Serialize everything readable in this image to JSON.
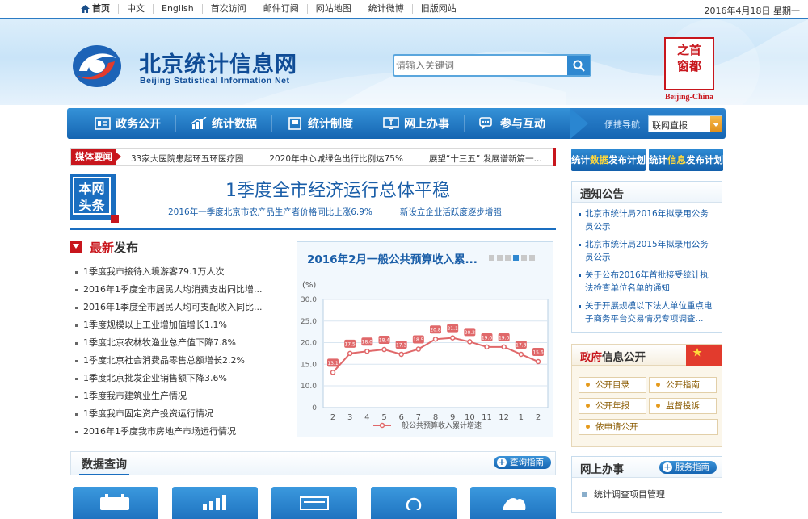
{
  "topbar": {
    "home": "首页",
    "links": [
      "中文",
      "English",
      "首次访问",
      "邮件订阅",
      "网站地图",
      "统计微博",
      "旧版网站"
    ],
    "date": "2016年4月18日 星期一"
  },
  "header": {
    "title": "北京统计信息网",
    "subtitle": "Beijing Statistical Information Net",
    "search_placeholder": "请输入关键词",
    "seal_text": [
      "首",
      "都",
      "之",
      "窗"
    ],
    "seal_caption": "Beijing-China"
  },
  "nav": {
    "items": [
      "政务公开",
      "统计数据",
      "统计制度",
      "网上办事",
      "参与互动"
    ],
    "quick_label": "便捷导航",
    "quick_value": "联网直报"
  },
  "ticker": {
    "tag": "媒体要闻",
    "items": [
      "33家大医院患起环五环医疗圈",
      "2020年中心城绿色出行比例达75%",
      "展望“十三五” 发展谱新篇一..."
    ]
  },
  "plans": [
    {
      "pre": "统计",
      "hl": "数据",
      "post": "发布计划"
    },
    {
      "pre": "统计",
      "hl": "信息",
      "post": "发布计划"
    }
  ],
  "headline": {
    "tag": [
      "本网",
      "头条"
    ],
    "title": "1季度全市经济运行总体平稳",
    "sublinks": [
      "2016年一季度北京市农产品生产者价格同比上涨6.9%",
      "新设立企业活跃度逐步增强"
    ]
  },
  "latest": {
    "title_red": "最新",
    "title_rest": "发布",
    "items": [
      "1季度我市接待入境游客79.1万人次",
      "2016年1季度全市居民人均消费支出同比增...",
      "2016年1季度全市居民人均可支配收入同比...",
      "1季度规模以上工业增加值增长1.1%",
      "1季度北京农林牧渔业总产值下降7.8%",
      "1季度北京社会消费品零售总额增长2.2%",
      "1季度北京批发企业销售额下降3.6%",
      "1季度我市建筑业生产情况",
      "1季度我市固定资产投资运行情况",
      "2016年1季度我市房地产市场运行情况"
    ]
  },
  "chart_data": {
    "type": "line",
    "title": "2016年2月一般公共预算收入累...",
    "ylabel": "(%)",
    "ylim": [
      0,
      30
    ],
    "yticks": [
      "0",
      "10.0",
      "15.0",
      "20.0",
      "25.0",
      "30.0"
    ],
    "categories": [
      "2",
      "3",
      "4",
      "5",
      "6",
      "7",
      "8",
      "9",
      "10",
      "11",
      "12",
      "1",
      "2"
    ],
    "series": [
      {
        "name": "一般公共预算收入累计增速",
        "values": [
          13.1,
          17.5,
          18.0,
          18.4,
          17.3,
          18.5,
          20.8,
          21.1,
          20.2,
          19.0,
          19.0,
          17.3,
          15.6
        ]
      }
    ],
    "labels": [
      "13.1",
      "17.5",
      "18.0",
      "18.4",
      "17.3",
      "18.5",
      "20.8",
      "21.1",
      "20.2",
      "19.0",
      "19.0",
      "17.3",
      "15.6"
    ],
    "grid": true,
    "legend_position": "bottom",
    "pager_dots": 6,
    "pager_active": 3,
    "colors": {
      "line": "#e0686a",
      "grid": "#d9e6f1"
    }
  },
  "dataquery": {
    "title": "数据查询",
    "guide": "查询指南"
  },
  "notice": {
    "title": "通知公告",
    "items": [
      "北京市统计局2016年拟录用公务员公示",
      "北京市统计局2015年拟录用公务员公示",
      "关于公布2016年首批接受统计执法检查单位名单的通知",
      "关于开展规模以下法人单位重点电子商务平台交易情况专项调查..."
    ]
  },
  "gov": {
    "title_red": "政府",
    "title_rest": "信息公开",
    "buttons": [
      "公开目录",
      "公开指南",
      "公开年报",
      "监督投诉",
      "依申请公开"
    ]
  },
  "online": {
    "title": "网上办事",
    "guide": "服务指南",
    "item": "统计调查项目管理"
  },
  "colors": {
    "brand": "#1a6ec0",
    "accent_red": "#c8161d",
    "highlight": "#ffd83b"
  }
}
